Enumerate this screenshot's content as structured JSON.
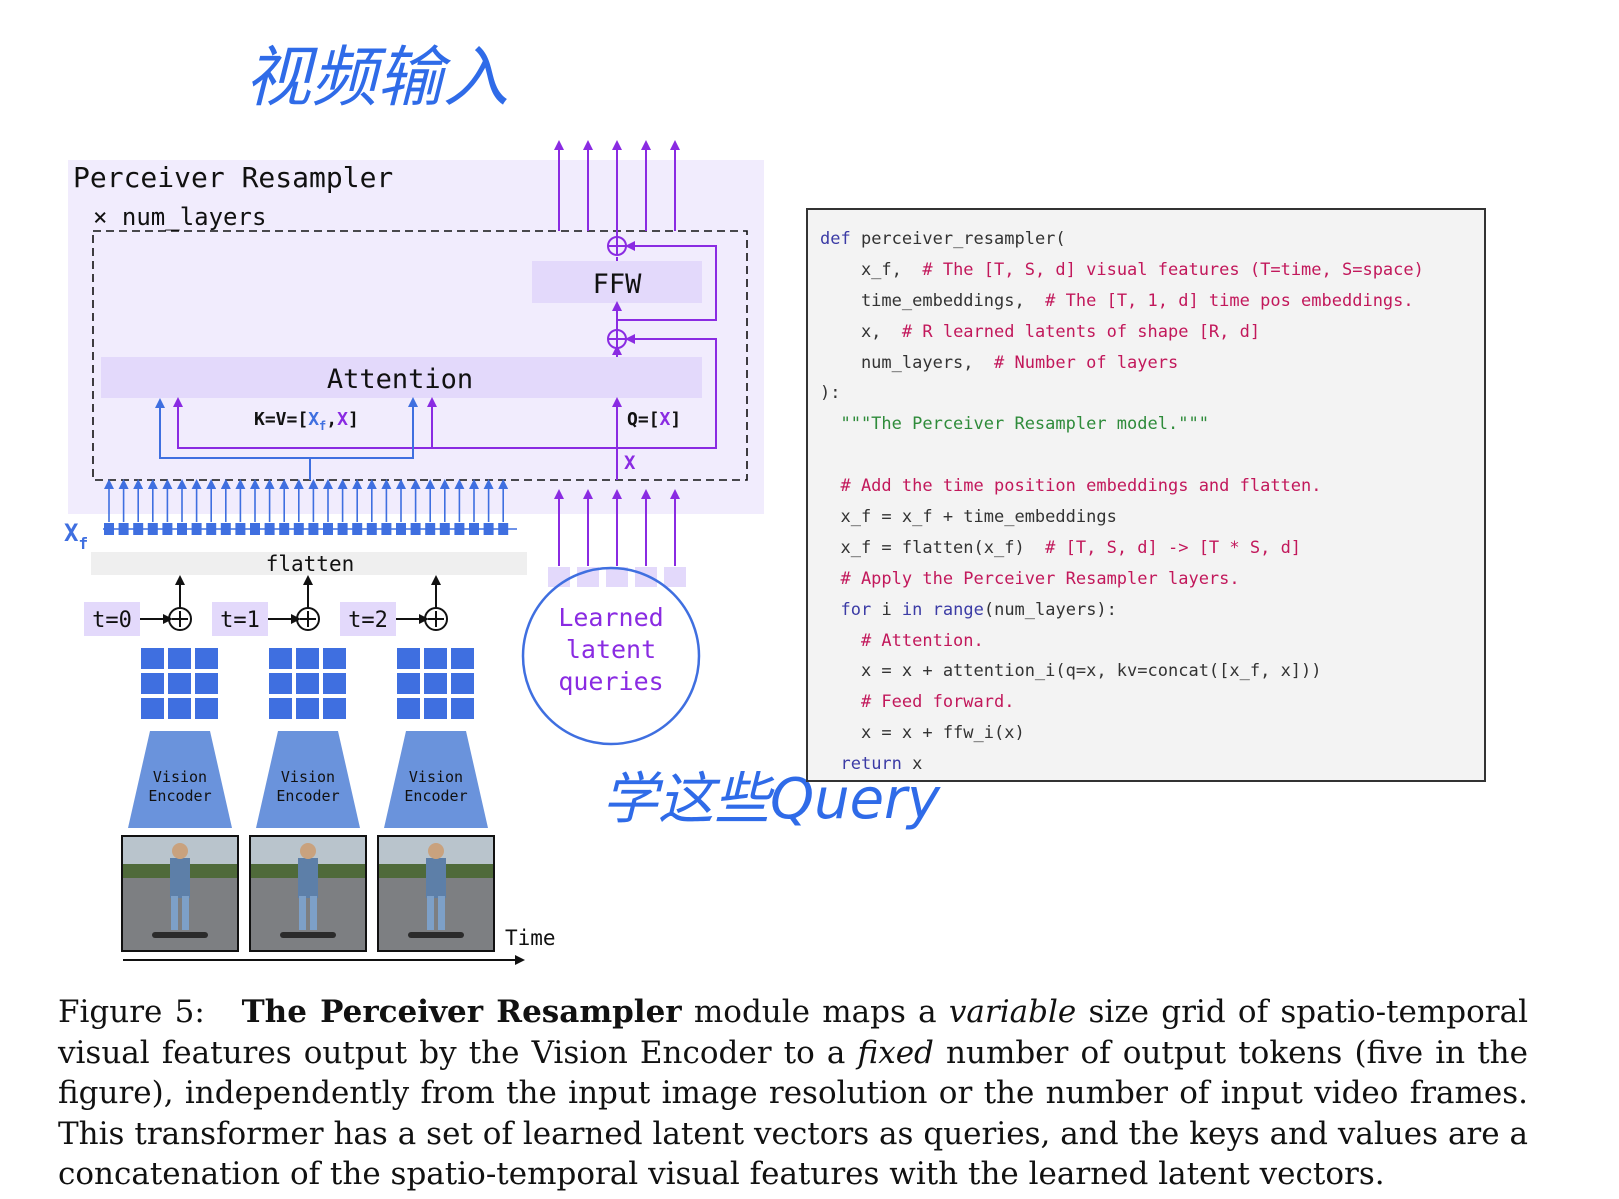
{
  "handwriting": {
    "top_note": "视频输入",
    "bottom_note": "学这些Query"
  },
  "diagram": {
    "module_title": "Perceiver Resampler",
    "layers_label": "× num_layers",
    "ffw_label": "FFW",
    "attention_label": "Attention",
    "kv_label_prefix": "K=V=[",
    "kv_xf": "X",
    "kv_xf_sub": "f",
    "kv_comma": ",",
    "kv_x": "X",
    "kv_label_suffix": "]",
    "q_label_prefix": "Q=[",
    "q_x": "X",
    "q_label_suffix": "]",
    "x_label": "X",
    "xf_label": "X",
    "xf_sub": "f",
    "flatten_label": "flatten",
    "time_tags": [
      "t=0",
      "t=1",
      "t=2"
    ],
    "encoder_label_line1": "Vision",
    "encoder_label_line2": "Encoder",
    "latent_label_lines": [
      "Learned",
      "latent",
      "queries"
    ],
    "time_axis_label": "Time",
    "colors": {
      "panel_bg": "#f1ecfd",
      "block_bg": "#e3d9fb",
      "purple": "#8a2be2",
      "blue": "#3f6fe0",
      "encoder": "#6a93dc"
    }
  },
  "code": {
    "lines": [
      {
        "segments": [
          {
            "t": "def ",
            "c": "kw"
          },
          {
            "t": "perceiver_resampler(",
            "c": ""
          }
        ]
      },
      {
        "segments": [
          {
            "t": "    x_f,  ",
            "c": ""
          },
          {
            "t": "# The [T, S, d] visual features (T=time, S=space)",
            "c": "cm"
          }
        ]
      },
      {
        "segments": [
          {
            "t": "    time_embeddings,  ",
            "c": ""
          },
          {
            "t": "# The [T, 1, d] time pos embeddings.",
            "c": "cm"
          }
        ]
      },
      {
        "segments": [
          {
            "t": "    x,  ",
            "c": ""
          },
          {
            "t": "# R learned latents of shape [R, d]",
            "c": "cm"
          }
        ]
      },
      {
        "segments": [
          {
            "t": "    num_layers,  ",
            "c": ""
          },
          {
            "t": "# Number of layers",
            "c": "cm"
          }
        ]
      },
      {
        "segments": [
          {
            "t": "):",
            "c": ""
          }
        ]
      },
      {
        "segments": [
          {
            "t": "  \"\"\"The Perceiver Resampler model.\"\"\"",
            "c": "st"
          }
        ]
      },
      {
        "segments": [
          {
            "t": "",
            "c": ""
          }
        ]
      },
      {
        "segments": [
          {
            "t": "  # Add the time position embeddings and flatten.",
            "c": "cm"
          }
        ]
      },
      {
        "segments": [
          {
            "t": "  x_f = x_f + time_embeddings",
            "c": ""
          }
        ]
      },
      {
        "segments": [
          {
            "t": "  x_f = flatten(x_f)  ",
            "c": ""
          },
          {
            "t": "# [T, S, d] -> [T * S, d]",
            "c": "cm"
          }
        ]
      },
      {
        "segments": [
          {
            "t": "  # Apply the Perceiver Resampler layers.",
            "c": "cm"
          }
        ]
      },
      {
        "segments": [
          {
            "t": "  ",
            "c": ""
          },
          {
            "t": "for",
            "c": "kw"
          },
          {
            "t": " i ",
            "c": ""
          },
          {
            "t": "in",
            "c": "kw"
          },
          {
            "t": " ",
            "c": ""
          },
          {
            "t": "range",
            "c": "kw"
          },
          {
            "t": "(num_layers):",
            "c": ""
          }
        ]
      },
      {
        "segments": [
          {
            "t": "    # Attention.",
            "c": "cm"
          }
        ]
      },
      {
        "segments": [
          {
            "t": "    x = x + attention_i(q=x, kv=concat([x_f, x]))",
            "c": ""
          }
        ]
      },
      {
        "segments": [
          {
            "t": "    # Feed forward.",
            "c": "cm"
          }
        ]
      },
      {
        "segments": [
          {
            "t": "    x = x + ffw_i(x)",
            "c": ""
          }
        ]
      },
      {
        "segments": [
          {
            "t": "  ",
            "c": ""
          },
          {
            "t": "return",
            "c": "kw"
          },
          {
            "t": " x",
            "c": ""
          }
        ]
      }
    ]
  },
  "caption": {
    "label": "Figure 5:",
    "bold_title": "The Perceiver Resampler",
    "part1": " module maps a ",
    "italic1": "variable",
    "part2": " size grid of spatio-temporal visual features output by the Vision Encoder to a ",
    "italic2": "fixed",
    "part3": " number of output tokens (five in the figure), independently from the input image resolution or the number of input video frames. This transformer has a set of learned latent vectors as queries, and the keys and values are a concatenation of the spatio-temporal visual features with the learned latent vectors."
  }
}
